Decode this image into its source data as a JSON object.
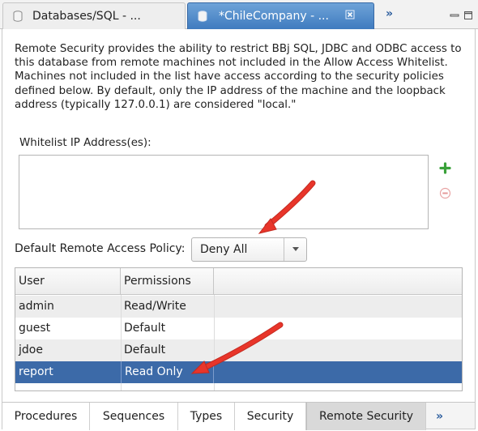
{
  "tabs": [
    {
      "label": "Databases/SQL - ...",
      "active": false
    },
    {
      "label": "*ChileCompany - ...",
      "active": true
    }
  ],
  "tab_overflow_label": "»",
  "description": "Remote Security provides the ability to restrict BBj SQL, JDBC and ODBC access to this database from remote machines not included in the Allow Access Whitelist.  Machines not included in the list have access according to the security policies defined below.  By default, only the IP address of the machine and the loopback address (typically 127.0.0.1) are considered \"local.\"",
  "whitelist": {
    "label": "Whitelist IP Address(es):",
    "entries": []
  },
  "policy": {
    "label": "Default Remote Access Policy:",
    "value": "Deny All"
  },
  "table": {
    "headers": {
      "user": "User",
      "permissions": "Permissions"
    },
    "rows": [
      {
        "user": "admin",
        "permissions": "Read/Write"
      },
      {
        "user": "guest",
        "permissions": "Default"
      },
      {
        "user": "jdoe",
        "permissions": "Default"
      },
      {
        "user": "report",
        "permissions": "Read Only",
        "selected": true
      }
    ]
  },
  "bottom_tabs": [
    {
      "label": "Procedures"
    },
    {
      "label": "Sequences"
    },
    {
      "label": "Types"
    },
    {
      "label": "Security"
    },
    {
      "label": "Remote Security",
      "active": true
    }
  ],
  "bottom_overflow_label": "»",
  "colors": {
    "active_tab": "#4a86c8",
    "selected_row": "#3c6aa8",
    "add_icon": "#3aa13a",
    "remove_icon": "#e59a9a",
    "annotation_arrow": "#e8352a"
  },
  "icons": {
    "tab_icon": "database-icon",
    "close": "close-icon",
    "add": "plus-icon",
    "remove": "minus-icon",
    "dropdown": "chevron-down-icon"
  }
}
